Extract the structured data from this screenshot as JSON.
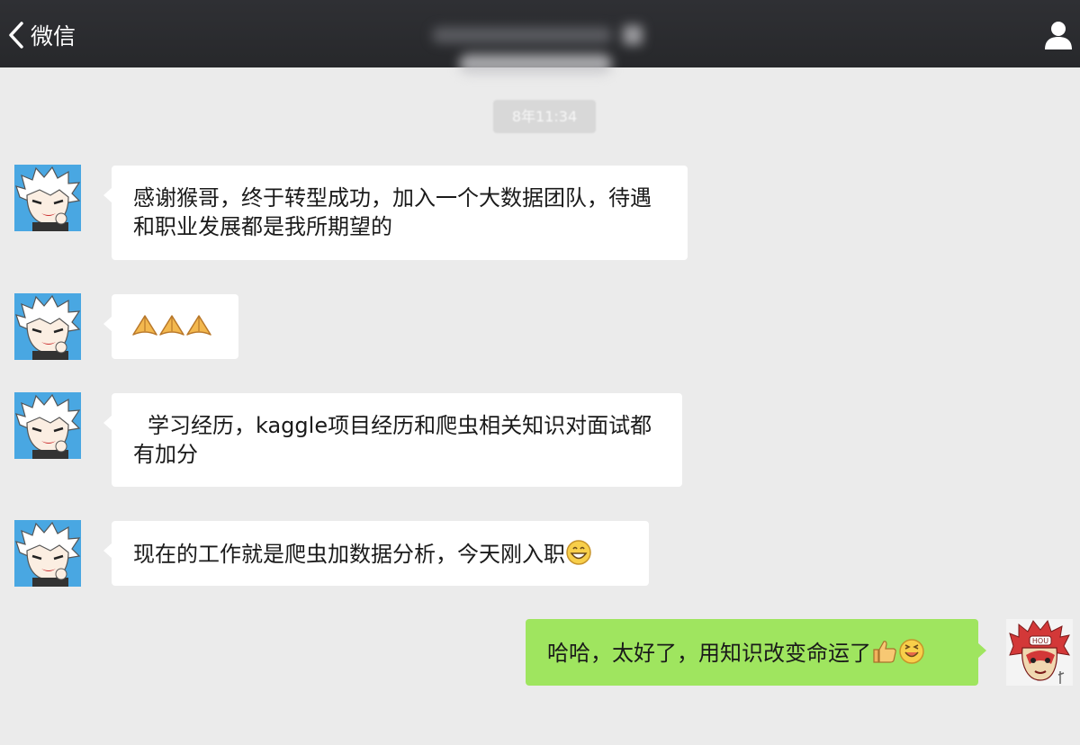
{
  "header": {
    "back_label": "微信",
    "back_icon": "chevron-left-icon",
    "profile_icon": "person-icon"
  },
  "chat": {
    "timestamp": "8年11:34",
    "messages": [
      {
        "side": "incoming",
        "text": "感谢猴哥，终于转型成功，加入一个大数据团队，待遇和职业发展都是我所期望的"
      },
      {
        "side": "incoming",
        "emoji": [
          "pray-icon",
          "pray-icon",
          "pray-icon"
        ]
      },
      {
        "side": "incoming",
        "text": "学习经历，kaggle项目经历和爬虫相关知识对面试都有加分"
      },
      {
        "side": "incoming",
        "text": "现在的工作就是爬虫加数据分析，今天刚入职",
        "emoji": [
          "grin-icon"
        ]
      },
      {
        "side": "outgoing",
        "text": "哈哈，太好了，用知识改变命运了",
        "emoji": [
          "thumbs-up-icon",
          "smile-icon"
        ]
      }
    ]
  },
  "colors": {
    "header_bg": "#2c2d31",
    "chat_bg": "#ebebeb",
    "incoming_bubble": "#ffffff",
    "outgoing_bubble": "#9fe55f"
  }
}
